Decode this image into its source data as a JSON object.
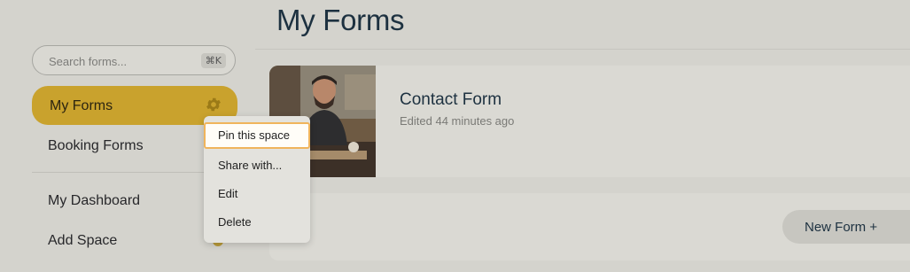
{
  "header": {
    "title": "My Forms"
  },
  "sidebar": {
    "search": {
      "placeholder": "Search forms...",
      "shortcut": "⌘K"
    },
    "items": [
      {
        "label": "My Forms",
        "active": true
      },
      {
        "label": "Booking Forms"
      },
      {
        "label": "My Dashboard"
      },
      {
        "label": "Add Space"
      }
    ]
  },
  "context_menu": {
    "items": [
      {
        "label": "Pin this space",
        "highlighted": true
      },
      {
        "label": "Share with..."
      },
      {
        "label": "Edit"
      },
      {
        "label": "Delete"
      }
    ]
  },
  "forms": [
    {
      "title": "Contact Form",
      "meta": "Edited 44 minutes ago"
    }
  ],
  "actions": {
    "new_form": "New Form +"
  },
  "colors": {
    "accent": "#c9a22d",
    "background": "#d4d3cd",
    "title": "#1d3140",
    "menu_highlight_border": "#f0b45c"
  },
  "icons": {
    "space_settings": "gear-icon"
  }
}
